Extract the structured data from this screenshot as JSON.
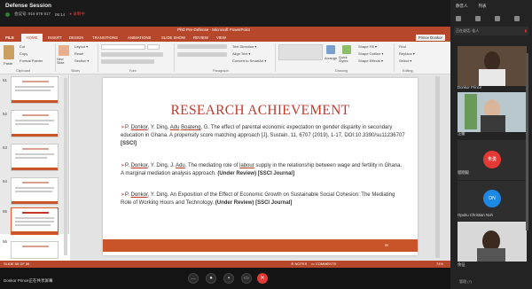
{
  "meeting": {
    "title": "Defense Session",
    "id": "会议号: 916 878 917",
    "duration": "06:14",
    "recording": "● 录制中",
    "presenter": "Donkor Prince正在共享屏幕"
  },
  "ppt": {
    "window_title": "PhD Pre-Defense - Microsoft PowerPoint",
    "tabs": [
      "FILE",
      "HOME",
      "INSERT",
      "DESIGN",
      "TRANSITIONS",
      "ANIMATIONS",
      "SLIDE SHOW",
      "REVIEW",
      "VIEW"
    ],
    "sign_in": "Prince Donkor",
    "ribbon": {
      "cut": "Cut",
      "copy": "Copy",
      "format_painter": "Format Painter",
      "paste": "Paste",
      "new_slide": "New Slide",
      "layout": "Layout ▾",
      "reset": "Reset",
      "section": "Section ▾",
      "text_direction": "Text Direction ▾",
      "align_text": "Align Text ▾",
      "smartart": "Convert to SmartArt ▾",
      "arrange": "Arrange",
      "quick_styles": "Quick Styles",
      "shape_fill": "Shape Fill ▾",
      "shape_outline": "Shape Outline ▾",
      "shape_effects": "Shape Effects ▾",
      "find": "Find",
      "replace": "Replace ▾",
      "select": "Select ▾",
      "groups": [
        "Clipboard",
        "Slides",
        "Font",
        "Paragraph",
        "Drawing",
        "Editing"
      ]
    },
    "thumbnails": [
      "51",
      "52",
      "53",
      "54",
      "55",
      "56"
    ],
    "status": {
      "slide": "SLIDE 55 OF 56",
      "notes": "≙ NOTES",
      "comments": "▭ COMMENTS",
      "zoom": "74%"
    }
  },
  "slide": {
    "title": "RESEARCH ACHIEVEMENT",
    "bullets": [
      {
        "pre": "P. ",
        "a1": "Donkor",
        "mid1": ", Y. Ding, ",
        "a2": "Adu",
        "mid2": " ",
        "a3": "Boateng",
        "rest": ", G. The effect of parental economic expectation on gender disparity in secondary education in Ghana. A propensity score matching approach [J], Sustain. 11, 6707 (2019), 1-17, DOI:10.3390/su11236707 ",
        "tag": "[SSCI]"
      },
      {
        "pre": "P. ",
        "a1": "Donkor",
        "mid1": ", Y. Ding, J. ",
        "a2": "Adu",
        "mid2": ". The mediating role of ",
        "a3": "labour",
        "rest": " supply in the relationship between wage and fertility in Ghana. A marginal mediation analysis approach. ",
        "tag": "(Under Review) [SSCI Journal]"
      },
      {
        "pre": "P. ",
        "a1": "Donkor",
        "mid1": ", Y. Ding. An Exposition of the Effect of Economic Growth on Sustainable Social Cohesion: The Mediating Role of Working Hours and Technology. ",
        "tag": "(Under Review) [SSCI Journal]"
      }
    ],
    "page_number": "55"
  },
  "panel": {
    "tabs": [
      "静音人",
      "列表"
    ],
    "host_label": "正在说话: 佳人",
    "participants": [
      {
        "name": "Donkor Prince"
      },
      {
        "name": "汪媛"
      },
      {
        "name": "程刚毅",
        "initials": "朱勇"
      },
      {
        "name": "Opoku Christian Nuh",
        "initials": "ON"
      },
      {
        "name": "余征"
      }
    ],
    "footer": "管理 (7)"
  }
}
